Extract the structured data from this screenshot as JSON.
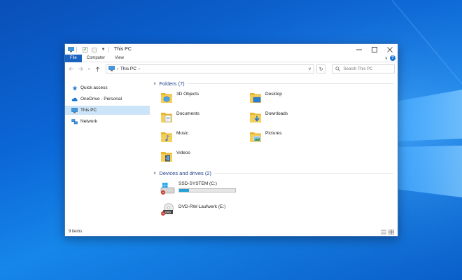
{
  "window": {
    "title": "This PC"
  },
  "ribbon": {
    "tabs": [
      "File",
      "Computer",
      "View"
    ]
  },
  "address": {
    "location": "This PC",
    "search_placeholder": "Search This PC"
  },
  "navpane": {
    "items": [
      {
        "label": "Quick access",
        "icon": "star-icon",
        "selected": false
      },
      {
        "label": "OneDrive - Personal",
        "icon": "cloud-icon",
        "selected": false
      },
      {
        "label": "This PC",
        "icon": "computer-icon",
        "selected": true
      },
      {
        "label": "Network",
        "icon": "network-icon",
        "selected": false
      }
    ]
  },
  "folders": {
    "heading": "Folders (7)",
    "items": [
      {
        "label": "3D Objects",
        "icon": "3d-objects-folder-icon"
      },
      {
        "label": "Desktop",
        "icon": "desktop-folder-icon"
      },
      {
        "label": "Documents",
        "icon": "documents-folder-icon"
      },
      {
        "label": "Downloads",
        "icon": "downloads-folder-icon"
      },
      {
        "label": "Music",
        "icon": "music-folder-icon"
      },
      {
        "label": "Pictures",
        "icon": "pictures-folder-icon"
      },
      {
        "label": "Videos",
        "icon": "videos-folder-icon"
      }
    ]
  },
  "drives": {
    "heading": "Devices and drives (2)",
    "items": [
      {
        "label": "SSD-SYSTEM (C:)",
        "icon": "hard-drive-icon",
        "used_fraction": 0.18
      },
      {
        "label": "DVD-RW-Laufwerk (E:)",
        "icon": "dvd-drive-icon"
      }
    ]
  },
  "status": {
    "item_count": "9 items"
  },
  "colors": {
    "accent": "#1a63c0",
    "selection": "#cce4f7",
    "folder": "#f0c24a",
    "heading": "#1e3f8a",
    "drive_fill": "#26a0da"
  }
}
